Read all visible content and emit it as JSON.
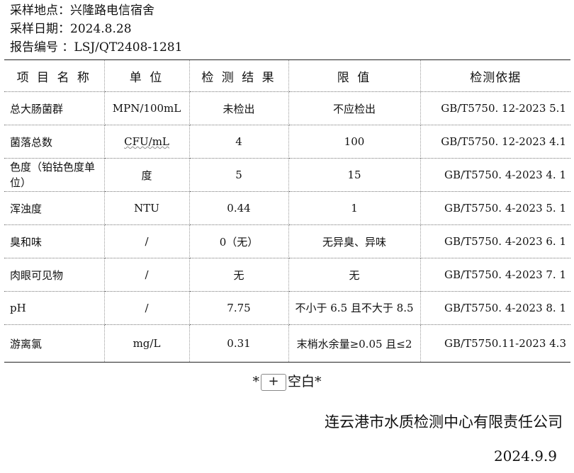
{
  "meta": {
    "location": "采样地点：兴隆路电信宿舍",
    "date": "采样日期：2024.8.28",
    "report_no": "报告编号 ：LSJ/QT2408-1281"
  },
  "table": {
    "headers": [
      "项 目 名 称",
      "单 位",
      "检 测 结 果",
      "限 值",
      "检测依据"
    ],
    "rows": [
      {
        "item": "总大肠菌群",
        "unit": "MPN/100mL",
        "result": "未检出",
        "limit": "不应检出",
        "standard": "GB/T5750. 12-2023    5.1"
      },
      {
        "item": "菌落总数",
        "unit": "CFU/mL",
        "result": "4",
        "limit": "100",
        "standard": "GB/T5750. 12-2023    4.1"
      },
      {
        "item": "色度（铂钴色度单位）",
        "unit": "度",
        "result": "5",
        "limit": "15",
        "standard": "GB/T5750. 4-2023    4. 1"
      },
      {
        "item": "浑浊度",
        "unit": "NTU",
        "result": "0.44",
        "limit": "1",
        "standard": "GB/T5750. 4-2023    5. 1"
      },
      {
        "item": "臭和味",
        "unit": "/",
        "result": "0（无）",
        "limit": "无异臭、异味",
        "standard": "GB/T5750. 4-2023    6. 1"
      },
      {
        "item": "肉眼可见物",
        "unit": "/",
        "result": "无",
        "limit": "无",
        "standard": "GB/T5750. 4-2023    7. 1"
      },
      {
        "item": "pH",
        "unit": "/",
        "result": "7.75",
        "limit": "不小于 6.5 且不大于 8.5",
        "standard": "GB/T5750. 4-2023    8. 1"
      },
      {
        "item": "游离氯",
        "unit": "mg/L",
        "result": "0.31",
        "limit": "末梢水余量≥0.05 且≤2",
        "standard": "GB/T5750.11-2023    4.3"
      }
    ]
  },
  "blank": {
    "prefix": "*",
    "plus": "+",
    "label": "空白*"
  },
  "company": "连云港市水质检测中心有限责任公司",
  "sign_date": "2024.9.9"
}
